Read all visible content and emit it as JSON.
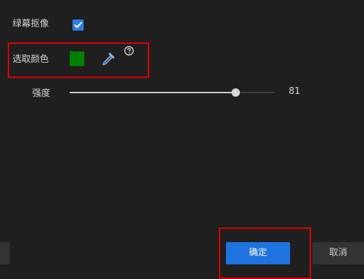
{
  "settings": {
    "green_screen_label": "绿幕抠像",
    "green_screen_enabled": true,
    "pick_color_label": "选取颜色",
    "picked_color": "#008000",
    "strength_label": "强度",
    "strength_value": "81",
    "strength_max": 100
  },
  "icons": {
    "checkbox": "checkmark-icon",
    "picker": "eyedropper-icon",
    "help": "question-circle-icon"
  },
  "highlight_color": "#e10000",
  "accent_color": "#1e73e0",
  "footer": {
    "ok_label": "确定",
    "cancel_label": "取消"
  }
}
